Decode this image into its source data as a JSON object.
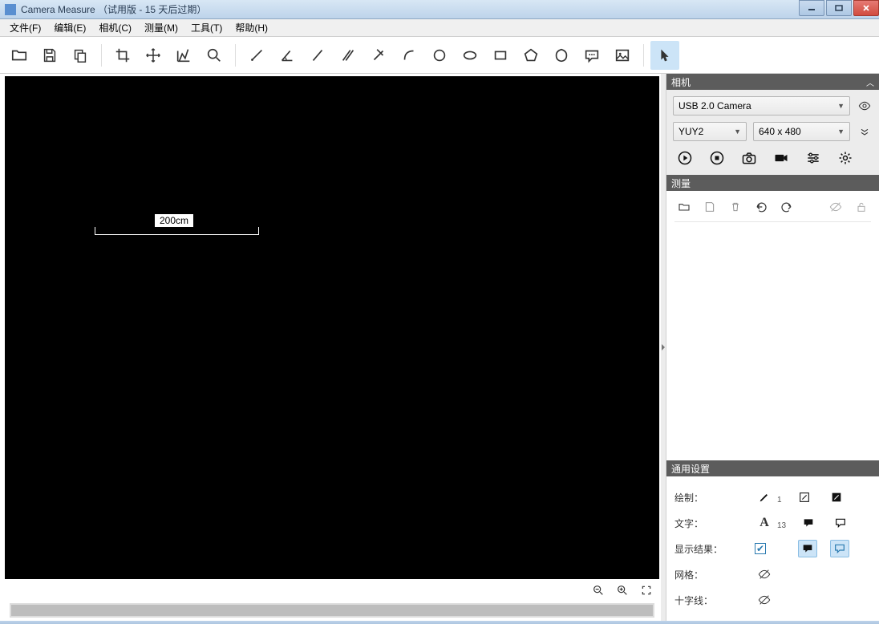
{
  "window": {
    "title": "Camera Measure （试用版 - 15 天后过期）"
  },
  "menu": {
    "file": "文件(F)",
    "edit": "编辑(E)",
    "camera": "相机(C)",
    "measure": "测量(M)",
    "tools": "工具(T)",
    "help": "帮助(H)"
  },
  "canvas": {
    "measurement_label": "200cm"
  },
  "panels": {
    "camera": {
      "title": "相机",
      "device": "USB 2.0 Camera",
      "format": "YUY2",
      "resolution": "640 x 480"
    },
    "measure": {
      "title": "测量"
    },
    "settings": {
      "title": "通用设置",
      "draw_label": "绘制：",
      "draw_size": "1",
      "text_label": "文字：",
      "text_size": "13",
      "result_label": "显示结果：",
      "grid_label": "网格：",
      "crosshair_label": "十字线："
    }
  }
}
